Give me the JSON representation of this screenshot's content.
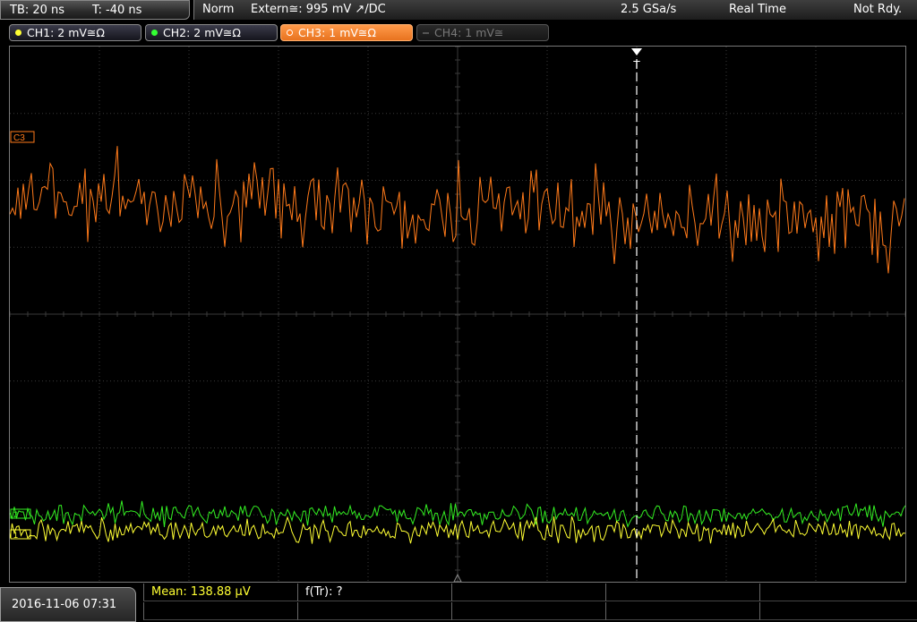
{
  "timebase": {
    "tb": "TB: 20 ns",
    "trigger_time": "T: -40 ns"
  },
  "acquisition": {
    "mode": "Norm",
    "trigger": "Extern≅: 995 mV ↗/DC",
    "sample_rate": "2.5 GSa/s",
    "acq_mode": "Real Time",
    "status": "Not Rdy."
  },
  "channels": [
    {
      "label": "CH1: 2 mV≅Ω",
      "color": "#ffff33",
      "state": "on"
    },
    {
      "label": "CH2: 2 mV≅Ω",
      "color": "#33ff33",
      "state": "on"
    },
    {
      "label": "CH3: 1 mV≅Ω",
      "color": "#ff7a1a",
      "state": "active"
    },
    {
      "label": "CH4: 1 mV≅",
      "color": "#777777",
      "state": "off"
    }
  ],
  "screen": {
    "ch3_marker": "C3",
    "trigger_marker": "T",
    "ch1_marker": "1",
    "ch2_marker": "2",
    "trace_colors": {
      "ch1": "#ffff33",
      "ch2": "#33ee22",
      "ch3": "#ff7a1a"
    },
    "grid_color": "#3a3a3a",
    "cursor_color": "#ffffff"
  },
  "datetime": "2016-11-06 07:31",
  "measurements": {
    "mean": "Mean: 138.88 µV",
    "freq": "f(Tr): ?"
  },
  "icons": {
    "trigger_arrow": "trigger-down-arrow-icon",
    "channel_dot": "channel-led-icon"
  }
}
